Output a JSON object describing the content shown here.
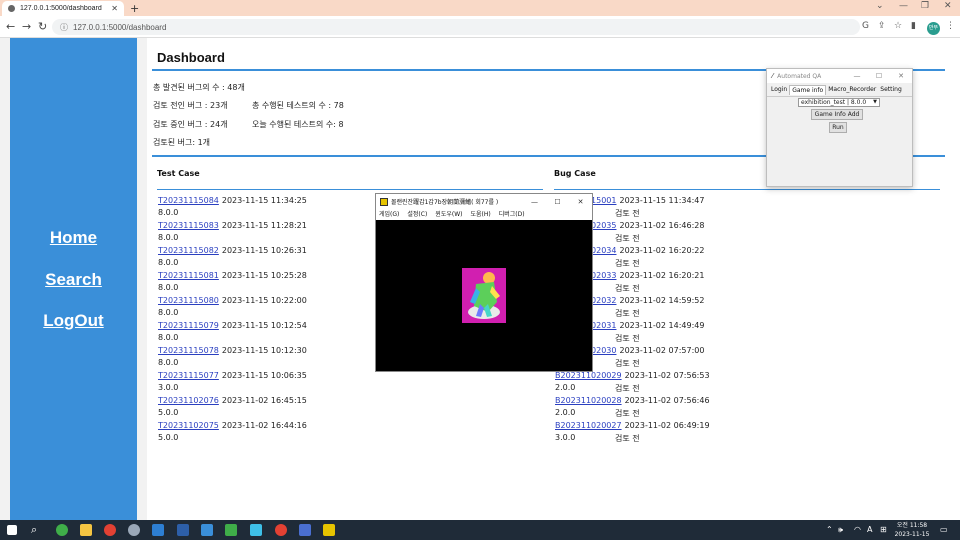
{
  "browser": {
    "tab_title": "127.0.0.1:5000/dashboard",
    "url": "127.0.0.1:5000/dashboard",
    "profile_initials": "만뚜"
  },
  "sidebar": {
    "items": [
      {
        "label": "Home"
      },
      {
        "label": "Search"
      },
      {
        "label": "LogOut"
      }
    ]
  },
  "dashboard": {
    "title": "Dashboard",
    "stats": {
      "total_found": "총 발견된 버그의 수 : 48개",
      "before_review": "검토 전인 버그 : 23개",
      "in_review": "검토 중인 버그 : 24개",
      "reviewed": "검토된 버그: 1개",
      "total_tests": "총 수행된 테스트의 수 : 78",
      "today_tests": "오늘 수행된 테스트의 수: 8"
    },
    "test_case_header": "Test Case",
    "bug_case_header": "Bug Case",
    "test_cases": [
      {
        "id": "T20231115084",
        "time": "2023-11-15 11:34:25",
        "version": "8.0.0"
      },
      {
        "id": "T20231115083",
        "time": "2023-11-15 11:28:21",
        "version": "8.0.0"
      },
      {
        "id": "T20231115082",
        "time": "2023-11-15 10:26:31",
        "version": "8.0.0"
      },
      {
        "id": "T20231115081",
        "time": "2023-11-15 10:25:28",
        "version": "8.0.0"
      },
      {
        "id": "T20231115080",
        "time": "2023-11-15 10:22:00",
        "version": "8.0.0"
      },
      {
        "id": "T20231115079",
        "time": "2023-11-15 10:12:54",
        "version": "8.0.0"
      },
      {
        "id": "T20231115078",
        "time": "2023-11-15 10:12:30",
        "version": "8.0.0"
      },
      {
        "id": "T20231115077",
        "time": "2023-11-15 10:06:35",
        "version": "3.0.0"
      },
      {
        "id": "T20231102076",
        "time": "2023-11-02 16:45:15",
        "version": "5.0.0"
      },
      {
        "id": "T20231102075",
        "time": "2023-11-02 16:44:16",
        "version": "5.0.0"
      }
    ],
    "bug_cases": [
      {
        "id": "B20231115001",
        "time": "2023-11-15 11:34:47",
        "status": "검토 전",
        "version": ""
      },
      {
        "id": "B20231102035",
        "time": "2023-11-02 16:46:28",
        "status": "검토 전",
        "version": ""
      },
      {
        "id": "B20231102034",
        "time": "2023-11-02 16:20:22",
        "status": "검토 전",
        "version": ""
      },
      {
        "id": "B20231102033",
        "time": "2023-11-02 16:20:21",
        "status": "검토 전",
        "version": ""
      },
      {
        "id": "B20231102032",
        "time": "2023-11-02 14:59:52",
        "status": "검토 전",
        "version": ""
      },
      {
        "id": "B20231102031",
        "time": "2023-11-02 14:49:49",
        "status": "검토 전",
        "version": ""
      },
      {
        "id": "B20231102030",
        "time": "2023-11-02 07:57:00",
        "status": "검토 전",
        "version": ""
      },
      {
        "id": "B202311020029",
        "time": "2023-11-02 07:56:53",
        "status": "검토 전",
        "version": "2.0.0"
      },
      {
        "id": "B202311020028",
        "time": "2023-11-02 07:56:46",
        "status": "검토 전",
        "version": "2.0.0"
      },
      {
        "id": "B202311020027",
        "time": "2023-11-02 06:49:19",
        "status": "검토 전",
        "version": "3.0.0"
      }
    ]
  },
  "qa_window": {
    "title": "Automated QA",
    "tabs": [
      "Login",
      "Game info",
      "Macro_Recorder",
      "Setting"
    ],
    "select_value": "exhibition_test | 8.0.0",
    "add_button": "Game Info Add",
    "run_button": "Run"
  },
  "game_window": {
    "title": "몰랜린잔躍갑1갑7b장朝蘭瀰鰭( 회77를 )",
    "menu": [
      "게임(G)",
      "설정(C)",
      "윈도우(W)",
      "도움(H)",
      "디버그(D)"
    ]
  },
  "taskbar": {
    "time": "오전 11:58",
    "date": "2023-11-15",
    "lang": "A"
  }
}
